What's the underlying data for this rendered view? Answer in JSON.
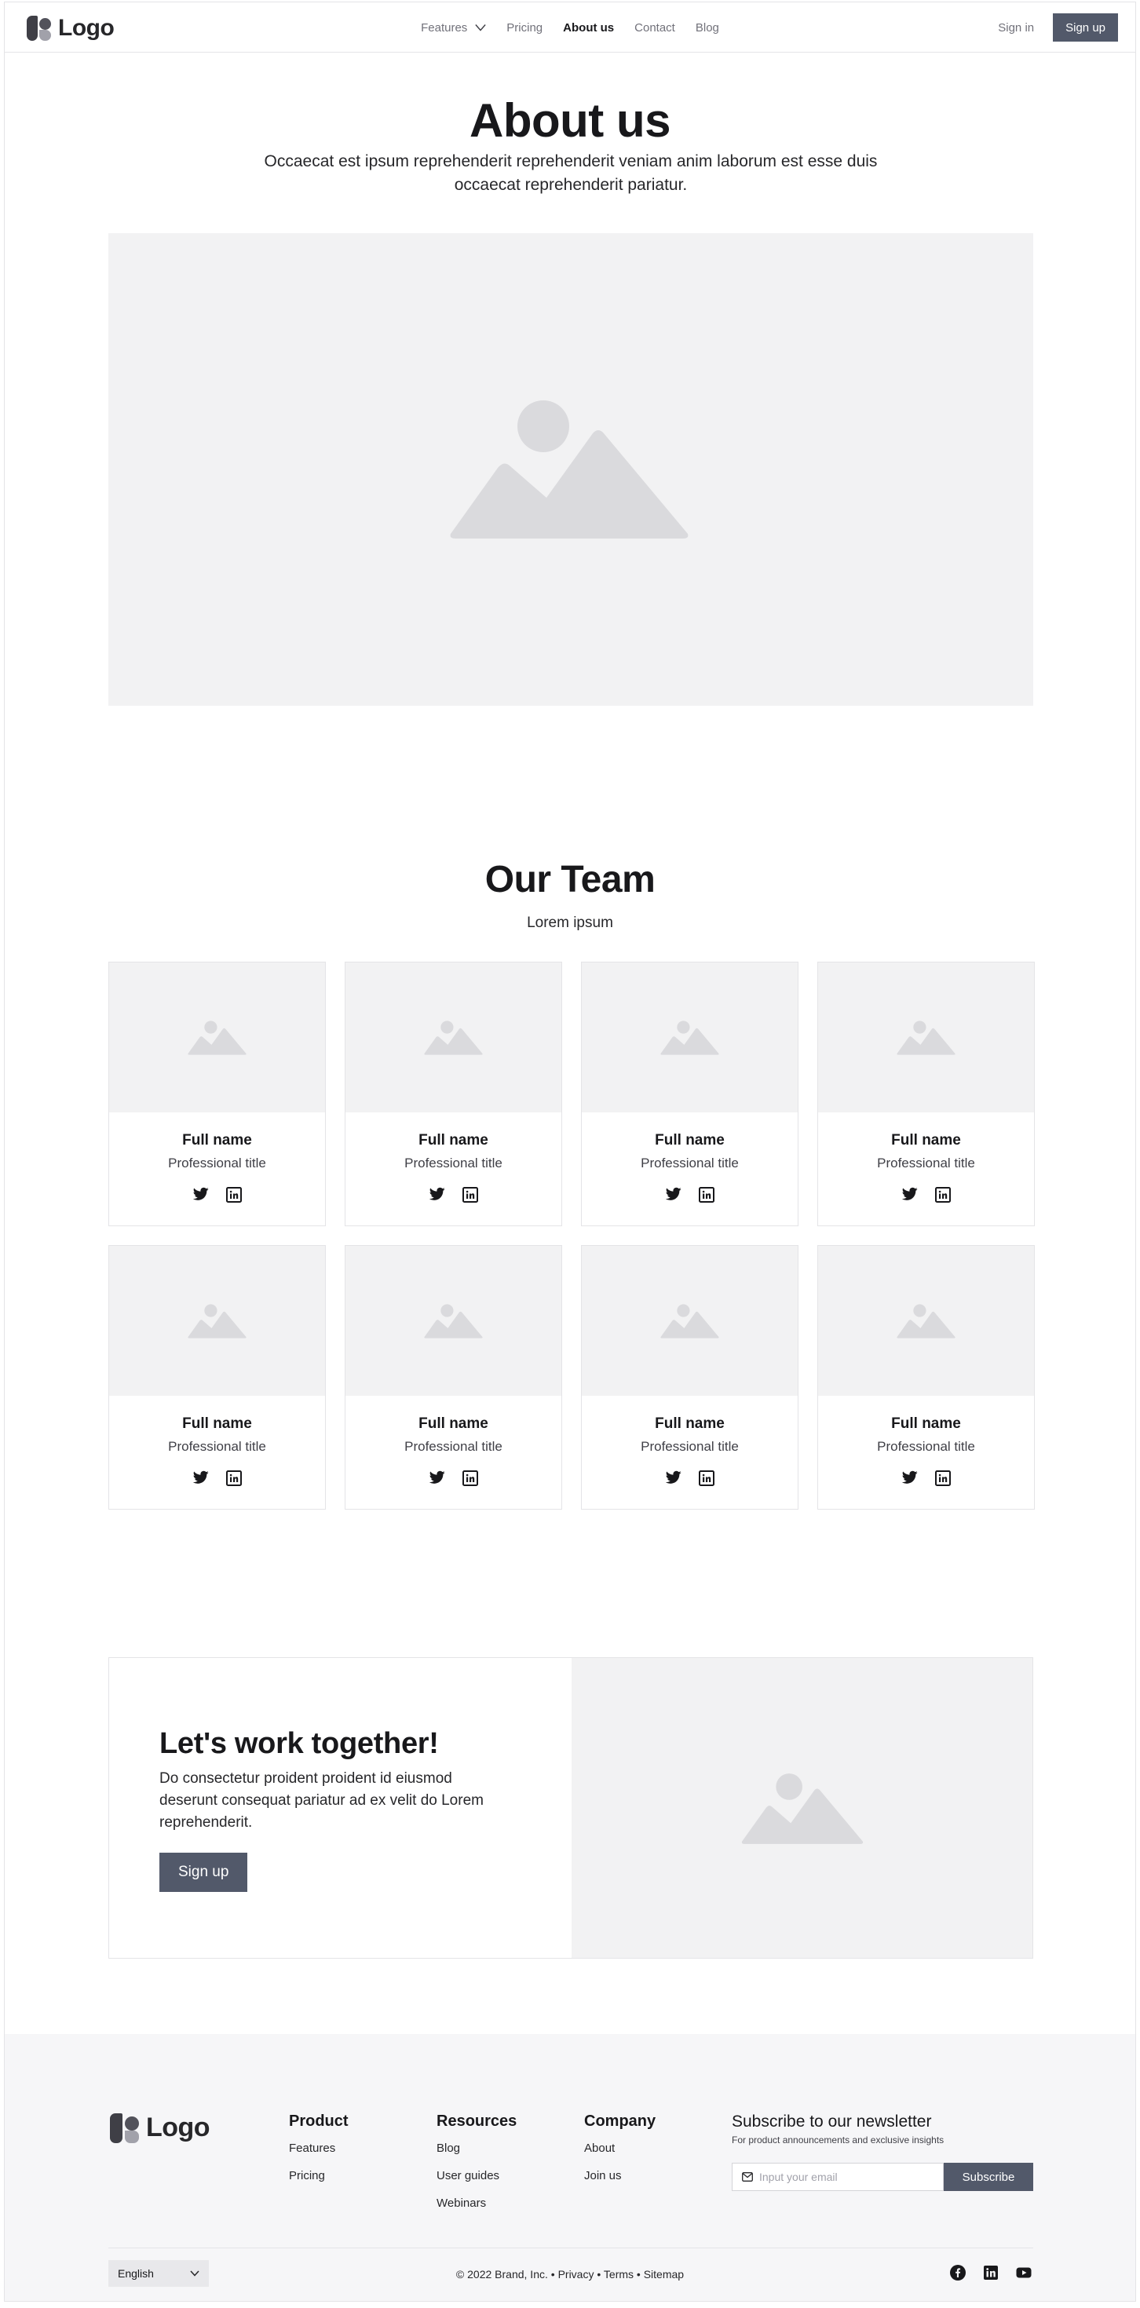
{
  "nav": {
    "logo_text": "Logo",
    "links": [
      {
        "label": "Features",
        "has_dropdown": true,
        "active": false
      },
      {
        "label": "Pricing",
        "active": false
      },
      {
        "label": "About us",
        "active": true
      },
      {
        "label": "Contact",
        "active": false
      },
      {
        "label": "Blog",
        "active": false
      }
    ],
    "sign_in": "Sign in",
    "sign_up": "Sign up"
  },
  "hero": {
    "title": "About us",
    "subtitle": "Occaecat est ipsum reprehenderit reprehenderit veniam anim laborum est esse duis occaecat reprehenderit pariatur.",
    "image_icon": "image-placeholder-icon"
  },
  "team": {
    "title": "Our Team",
    "subtitle": "Lorem ipsum",
    "members": [
      {
        "name": "Full name",
        "role": "Professional title"
      },
      {
        "name": "Full name",
        "role": "Professional title"
      },
      {
        "name": "Full name",
        "role": "Professional title"
      },
      {
        "name": "Full name",
        "role": "Professional title"
      },
      {
        "name": "Full name",
        "role": "Professional title"
      },
      {
        "name": "Full name",
        "role": "Professional title"
      },
      {
        "name": "Full name",
        "role": "Professional title"
      },
      {
        "name": "Full name",
        "role": "Professional title"
      }
    ],
    "social_icons": [
      "twitter-icon",
      "linkedin-icon"
    ]
  },
  "cta": {
    "title": "Let's work together!",
    "body": "Do consectetur proident proident id eiusmod deserunt consequat pariatur ad ex velit do Lorem reprehenderit.",
    "button": "Sign up"
  },
  "footer": {
    "logo_text": "Logo",
    "columns": [
      {
        "heading": "Product",
        "links": [
          "Features",
          "Pricing"
        ]
      },
      {
        "heading": "Resources",
        "links": [
          "Blog",
          "User guides",
          "Webinars"
        ]
      },
      {
        "heading": "Company",
        "links": [
          "About",
          "Join us"
        ]
      }
    ],
    "newsletter": {
      "title": "Subscribe to our newsletter",
      "subtitle": "For product announcements and exclusive insights",
      "placeholder": "Input your email",
      "button": "Subscribe"
    },
    "language": "English",
    "copyright": "© 2022 Brand, Inc.",
    "legal_links": [
      "Privacy",
      "Terms",
      "Sitemap"
    ],
    "separator": "•",
    "social_icons": [
      "facebook-icon",
      "linkedin-icon",
      "youtube-icon"
    ]
  },
  "colors": {
    "primary_button": "#52596a",
    "placeholder_bg": "#f2f2f3",
    "placeholder_shape": "#dadadd",
    "footer_bg": "#f6f6f8"
  }
}
